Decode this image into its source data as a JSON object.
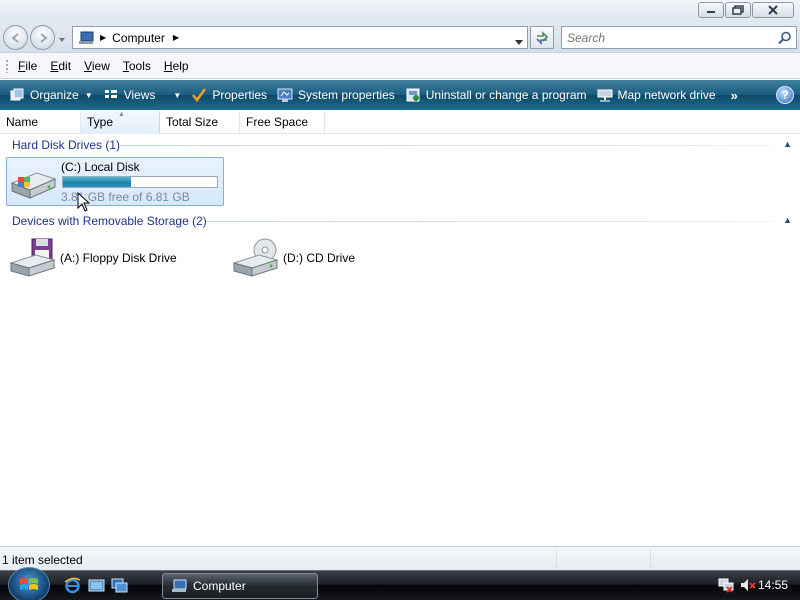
{
  "window": {
    "minimize_icon": "minimize-icon",
    "maximize_icon": "restore-icon",
    "close_icon": "close-icon"
  },
  "address": {
    "crumb": "Computer",
    "search_placeholder": "Search"
  },
  "menu": {
    "items": [
      {
        "label": "File",
        "accel": "F"
      },
      {
        "label": "Edit",
        "accel": "E"
      },
      {
        "label": "View",
        "accel": "V"
      },
      {
        "label": "Tools",
        "accel": "T"
      },
      {
        "label": "Help",
        "accel": "H"
      }
    ]
  },
  "commands": {
    "organize": "Organize",
    "views": "Views",
    "properties": "Properties",
    "system_properties": "System properties",
    "uninstall": "Uninstall or change a program",
    "map_drive": "Map network drive",
    "more": "»",
    "help": "?"
  },
  "columns": {
    "name": "Name",
    "type": "Type",
    "total_size": "Total Size",
    "free_space": "Free Space"
  },
  "groups": {
    "hard_disk": {
      "title": "Hard Disk Drives (1)",
      "drives": [
        {
          "label": "(C:) Local Disk",
          "free_text": "3.81 GB free of 6.81 GB",
          "used_fraction": 0.44,
          "selected": true
        }
      ]
    },
    "removable": {
      "title": "Devices with Removable Storage (2)",
      "drives": [
        {
          "label": "(A:) Floppy Disk Drive",
          "icon": "floppy-drive-icon"
        },
        {
          "label": "(D:) CD Drive",
          "icon": "cd-drive-icon"
        }
      ]
    }
  },
  "status": {
    "text": "1 item selected"
  },
  "taskbar": {
    "task_label": "Computer",
    "clock": "14:55"
  },
  "colors": {
    "command_bar": "#1b5c7e",
    "capacity_fill": "#1e7ea8",
    "group_header": "#1e3287"
  }
}
